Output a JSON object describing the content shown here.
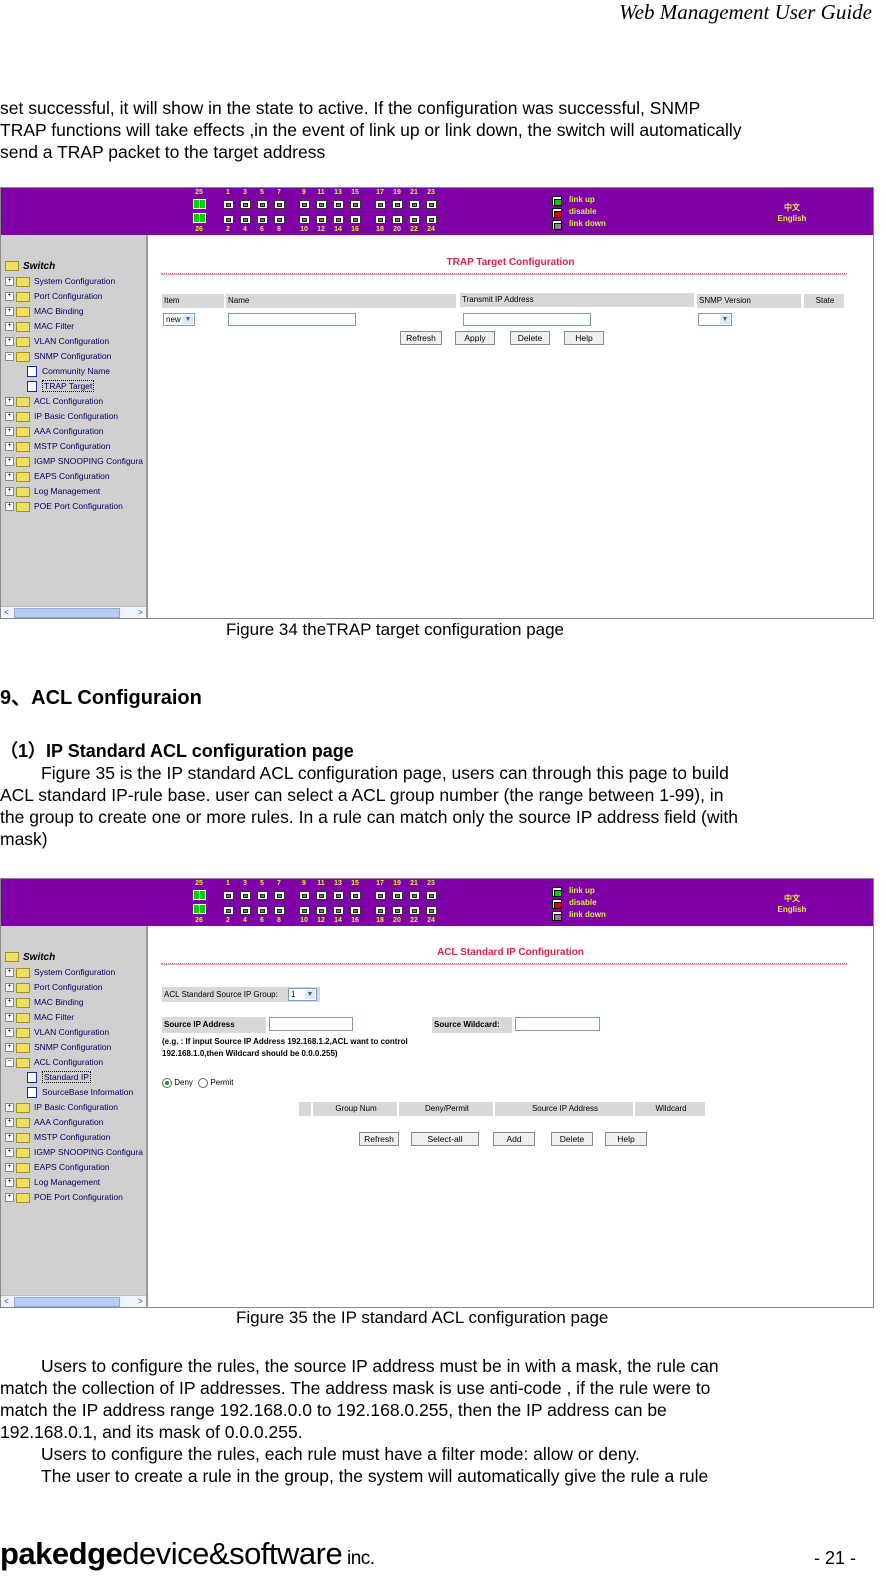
{
  "header": {
    "title": "Web Management User Guide"
  },
  "intro_paragraph": [
    "set successful, it will show in the state to active. If the configuration was successful, SNMP",
    "TRAP functions will take effects ,in the event of link up or link down, the switch will automatically",
    "send a TRAP packet to the target address"
  ],
  "switch_ui": {
    "ports_top": [
      "1",
      "3",
      "5",
      "7",
      "9",
      "11",
      "13",
      "15",
      "17",
      "19",
      "21",
      "23"
    ],
    "ports_bottom": [
      "2",
      "4",
      "6",
      "8",
      "10",
      "12",
      "14",
      "16",
      "18",
      "20",
      "22",
      "24"
    ],
    "uplink_top": "25",
    "uplink_bottom": "26",
    "legend": [
      {
        "label": "link up",
        "color": "#00d000"
      },
      {
        "label": "disable",
        "color": "#e00000"
      },
      {
        "label": "link down",
        "color": "#888888"
      }
    ],
    "languages": [
      "中文",
      "English"
    ],
    "colors": {
      "topbar": "#8000a8",
      "title": "#e02050",
      "sidebar": "#d0d0d0"
    }
  },
  "figure34": {
    "tree_root": "Switch",
    "tree": [
      {
        "label": "System Configuration",
        "type": "folder"
      },
      {
        "label": "Port Configuration",
        "type": "folder"
      },
      {
        "label": "MAC Binding",
        "type": "folder"
      },
      {
        "label": "MAC Filter",
        "type": "folder"
      },
      {
        "label": "VLAN Configuration",
        "type": "folder"
      },
      {
        "label": "SNMP Configuration",
        "type": "folder-open"
      },
      {
        "label": "Community Name",
        "type": "doc"
      },
      {
        "label": "TRAP Target",
        "type": "doc",
        "selected": true
      },
      {
        "label": "ACL Configuration",
        "type": "folder"
      },
      {
        "label": "IP Basic Configuration",
        "type": "folder"
      },
      {
        "label": "AAA Configuration",
        "type": "folder"
      },
      {
        "label": "MSTP Configuration",
        "type": "folder"
      },
      {
        "label": "IGMP SNOOPING Configura",
        "type": "folder"
      },
      {
        "label": "EAPS Configuration",
        "type": "folder"
      },
      {
        "label": "Log Management",
        "type": "folder"
      },
      {
        "label": "POE Port Configuration",
        "type": "folder"
      }
    ],
    "page_title": "TRAP Target Configuration",
    "columns": [
      "Item",
      "Name",
      "Transmit IP Address",
      "SNMP Version",
      "State"
    ],
    "item_select_value": "new",
    "name_value": "",
    "ip_value": "",
    "version_value": "",
    "buttons": [
      "Refresh",
      "Apply",
      "Delete",
      "Help"
    ],
    "caption": "Figure 34 theTRAP target configuration page"
  },
  "section9": {
    "heading": "9、ACL Configuraion"
  },
  "subsection1": {
    "heading": "（1）IP Standard ACL configuration page",
    "paragraph": [
      "Figure 35 is the IP standard ACL configuration page, users can through this page to build",
      "ACL standard IP-rule base. user can select a ACL group number (the range between 1-99), in",
      "the group to create one or more rules. In a rule can match only the source IP address field (with",
      "mask)"
    ]
  },
  "figure35": {
    "tree_root": "Switch",
    "tree": [
      {
        "label": "System Configuration",
        "type": "folder"
      },
      {
        "label": "Port Configuration",
        "type": "folder"
      },
      {
        "label": "MAC Binding",
        "type": "folder"
      },
      {
        "label": "MAC Filter",
        "type": "folder"
      },
      {
        "label": "VLAN Configuration",
        "type": "folder"
      },
      {
        "label": "SNMP Configuration",
        "type": "folder"
      },
      {
        "label": "ACL Configuration",
        "type": "folder-open"
      },
      {
        "label": "Standard IP",
        "type": "doc",
        "selected": true
      },
      {
        "label": "SourceBase Information",
        "type": "doc"
      },
      {
        "label": "IP Basic Configuration",
        "type": "folder"
      },
      {
        "label": "AAA Configuration",
        "type": "folder"
      },
      {
        "label": "MSTP Configuration",
        "type": "folder"
      },
      {
        "label": "IGMP SNOOPING Configura",
        "type": "folder"
      },
      {
        "label": "EAPS Configuration",
        "type": "folder"
      },
      {
        "label": "Log Management",
        "type": "folder"
      },
      {
        "label": "POE Port Configuration",
        "type": "folder"
      }
    ],
    "page_title": "ACL Standard IP Configuration",
    "group_label": "ACL Standard Source IP Group:",
    "group_value": "1",
    "source_ip_label": "Source IP Address",
    "source_ip_value": "",
    "wildcard_label": "Source Wildcard:",
    "wildcard_value": "",
    "hint_line1": "(e.g. : If input Source IP Address 192.168.1.2,ACL want to control",
    "hint_line2": "192.168.1.0,then Wildcard should be 0.0.0.255)",
    "radio_deny": "Deny",
    "radio_permit": "Permit",
    "radio_selected": "Deny",
    "columns": [
      "",
      "Group Num",
      "Deny/Permit",
      "Source IP Address",
      "Wildcard"
    ],
    "buttons": [
      "Refresh",
      "Select-all",
      "Add",
      "Delete",
      "Help"
    ],
    "caption": "Figure 35    the IP standard ACL configuration page"
  },
  "body_paragraphs": [
    "Users to configure the rules, the source IP address must be in with a mask, the rule can",
    "match the collection of IP addresses. The address mask is use anti-code , if the rule were to",
    "match the IP address range 192.168.0.0 to 192.168.0.255, then the IP address can be",
    "192.168.0.1, and its mask of 0.0.0.255.",
    "Users to configure the rules, each rule must have a filter mode: allow or deny.",
    "The user to create a rule in the group, the system will automatically give the rule a rule"
  ],
  "footer": {
    "logo_bold": "pakedge",
    "logo_rest": "device&software",
    "logo_inc": " inc.",
    "page_number": "- 21 -"
  }
}
